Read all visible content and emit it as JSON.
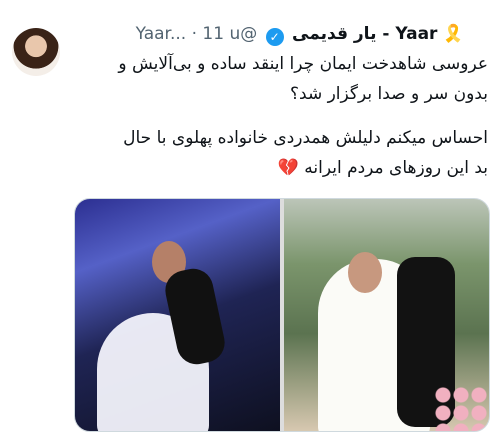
{
  "tweet": {
    "display_name": "Yaar - یار قدیمی",
    "name_decorations": "🎗️",
    "handle": "@Yaar...",
    "dot": "·",
    "timestamp": "11 u",
    "lines": [
      "عروسی شاهدخت ایمان چرا اینقد ساده و بی‌آلایش و",
      "بدون سر و صدا برگزار شد؟",
      "احساس میکنم دلیلش همدردی خانواده پهلوی با حال",
      "بد این روزهای مردم ایرانه"
    ],
    "heart": "💔"
  }
}
